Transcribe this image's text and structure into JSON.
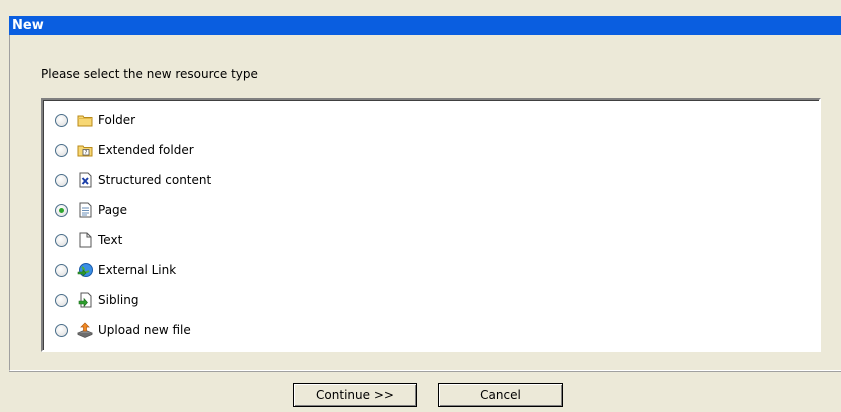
{
  "dialog": {
    "title": "New",
    "prompt": "Please select the new resource type"
  },
  "options": [
    {
      "label": "Folder",
      "icon": "folder-icon",
      "selected": false
    },
    {
      "label": "Extended folder",
      "icon": "extended-folder-icon",
      "selected": false
    },
    {
      "label": "Structured content",
      "icon": "structured-content-icon",
      "selected": false
    },
    {
      "label": "Page",
      "icon": "page-icon",
      "selected": true
    },
    {
      "label": "Text",
      "icon": "text-icon",
      "selected": false
    },
    {
      "label": "External Link",
      "icon": "external-link-icon",
      "selected": false
    },
    {
      "label": "Sibling",
      "icon": "sibling-icon",
      "selected": false
    },
    {
      "label": "Upload new file",
      "icon": "upload-icon",
      "selected": false
    }
  ],
  "buttons": {
    "continue_label": "Continue >>",
    "cancel_label": "Cancel"
  },
  "colors": {
    "title_bar": "#0a5ee0",
    "background": "#ece9d8",
    "radio_dot": "#2ea52e"
  }
}
